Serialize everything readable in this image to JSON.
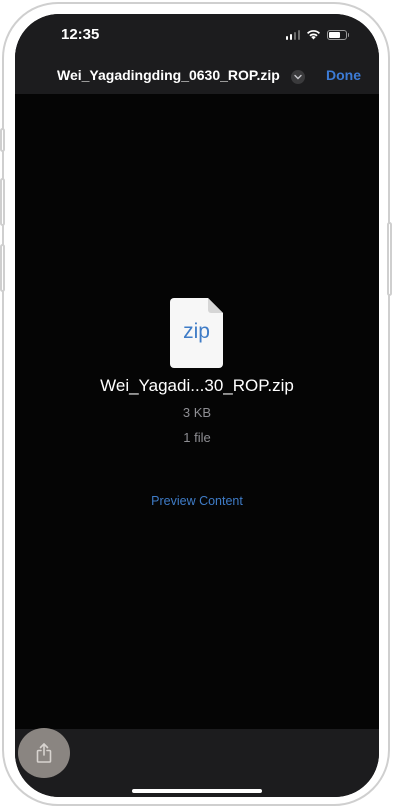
{
  "status_bar": {
    "time": "12:35",
    "icons": [
      "cellular-signal-icon",
      "wifi-icon",
      "battery-icon"
    ]
  },
  "header": {
    "title": "Wei_Yagadingding_0630_ROP.zip",
    "title_menu_icon": "chevron-down-icon",
    "done_label": "Done"
  },
  "file": {
    "icon_text": "zip",
    "name": "Wei_Yagadi...30_ROP.zip",
    "size": "3 KB",
    "count": "1 file"
  },
  "actions": {
    "preview_label": "Preview Content",
    "share_icon": "share-icon"
  },
  "colors": {
    "accent": "#3c7bd6",
    "background": "#050505",
    "bar": "#1c1c1e",
    "secondary_text": "#8e8e93"
  }
}
